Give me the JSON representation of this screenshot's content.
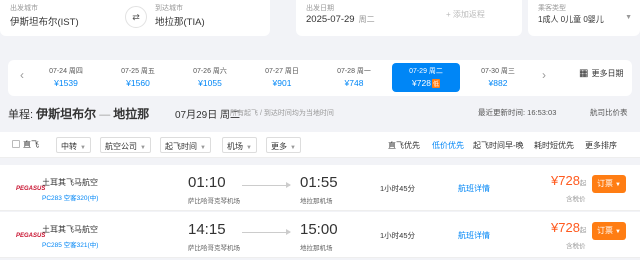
{
  "search": {
    "from_label": "出发城市",
    "from_value": "伊斯坦布尔(IST)",
    "to_label": "到达城市",
    "to_value": "地拉那(TIA)",
    "date_label": "出发日期",
    "date_value": "2025-07-29",
    "date_weekday": "周二",
    "return_placeholder": "+ 添加返程",
    "pax_label": "乘客类型",
    "pax_value": "1成人 0儿童 0婴儿",
    "swap_icon": "⇄",
    "caret": "▼"
  },
  "dates": {
    "prev": "‹",
    "next": "›",
    "items": [
      {
        "date": "07-24 周四",
        "price": "¥1539"
      },
      {
        "date": "07-25 周五",
        "price": "¥1560"
      },
      {
        "date": "07-26 周六",
        "price": "¥1055"
      },
      {
        "date": "07-27 周日",
        "price": "¥901"
      },
      {
        "date": "07-28 周一",
        "price": "¥748"
      },
      {
        "date": "07-29 周二",
        "price": "¥728",
        "badge": "低"
      },
      {
        "date": "07-30 周三",
        "price": "¥882"
      }
    ],
    "more_dates": "更多日期",
    "calendar_icon": "▦"
  },
  "trip": {
    "type": "单程:",
    "from": "伊斯坦布尔",
    "dash": " — ",
    "to": "地拉那",
    "date": "07月29日 周二",
    "note": "所有起飞 / 到达时间均为当地时间",
    "updated": "最近更新时间: 16:53:03",
    "compare": "航司比价表"
  },
  "filters": {
    "direct": "直飞",
    "transfer": "中转",
    "airline": "航空公司",
    "dep_time": "起飞时间",
    "airport": "机场",
    "more": "更多",
    "chevron": "▼",
    "sorts": [
      "直飞优先",
      "低价优先",
      "起飞时间早-晚",
      "耗时短优先",
      "更多排序"
    ],
    "active_sort": 1
  },
  "flights": [
    {
      "logo": "PEGASUS",
      "airline": "土耳其飞马航空",
      "flight_no": "PC283 空客320(中)",
      "dep_time": "01:10",
      "dep_airport": "萨比哈哥克琴机场",
      "arr_time": "01:55",
      "arr_airport": "地拉那机场",
      "duration": "1小时45分",
      "detail": "航班详情",
      "price": "¥728",
      "price_unit": "起",
      "tax": "含税价",
      "book": "订票"
    },
    {
      "logo": "PEGASUS",
      "airline": "土耳其飞马航空",
      "flight_no": "PC285 空客321(中)",
      "dep_time": "14:15",
      "dep_airport": "萨比哈哥克琴机场",
      "arr_time": "15:00",
      "arr_airport": "地拉那机场",
      "duration": "1小时45分",
      "detail": "航班详情",
      "price": "¥728",
      "price_unit": "起",
      "tax": "含税价",
      "book": "订票"
    }
  ]
}
